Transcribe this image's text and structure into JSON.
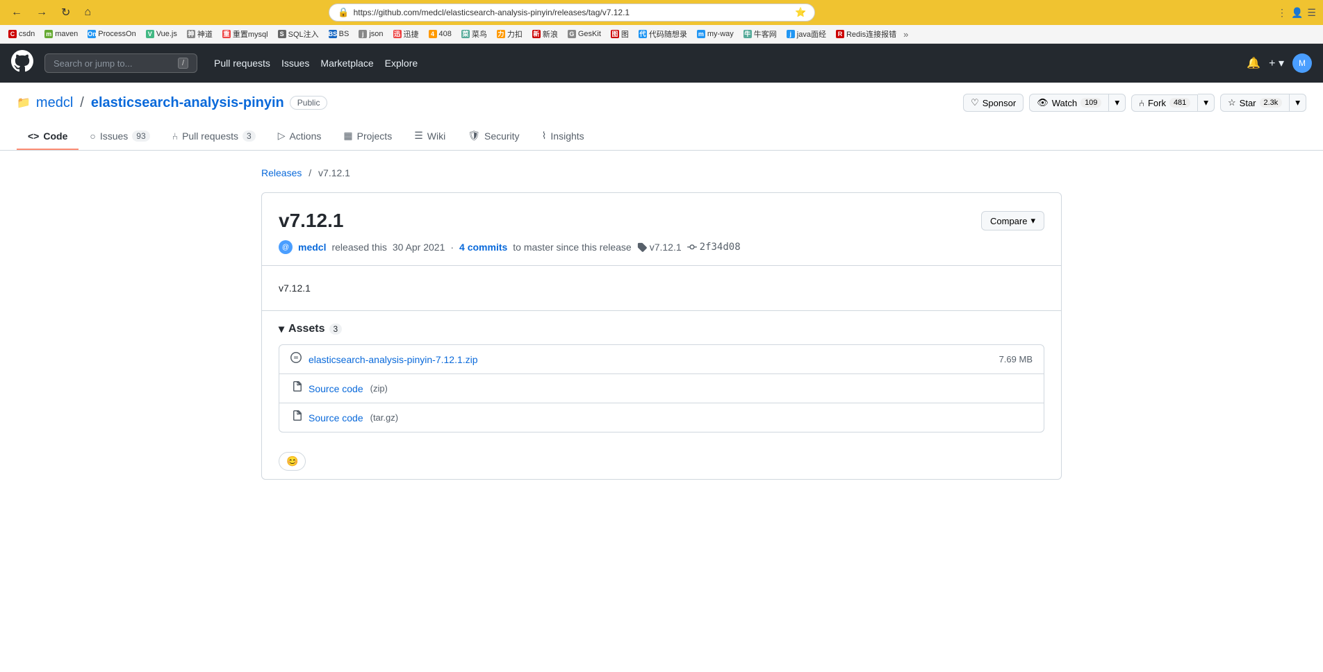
{
  "browser": {
    "url": "https://github.com/medcl/elasticsearch-analysis-pinyin/releases/tag/v7.12.1",
    "bookmarks": [
      {
        "label": "csdn",
        "color": "#c00"
      },
      {
        "label": "maven",
        "color": "#6a3"
      },
      {
        "label": "ProcessOn",
        "color": "#2196F3"
      },
      {
        "label": "Vue.js",
        "color": "#42b883"
      },
      {
        "label": "神道",
        "color": "#888"
      },
      {
        "label": "重置mysql",
        "color": "#e44"
      },
      {
        "label": "SQL注入",
        "color": "#666"
      },
      {
        "label": "BS",
        "color": "#1565C0"
      },
      {
        "label": "json",
        "color": "#888"
      },
      {
        "label": "迅捷",
        "color": "#e44"
      },
      {
        "label": "408",
        "color": "#f90"
      },
      {
        "label": "菜鸟",
        "color": "#5a9"
      },
      {
        "label": "力扣",
        "color": "#f90"
      },
      {
        "label": "新浪",
        "color": "#c00"
      },
      {
        "label": "GesKit",
        "color": "#888"
      },
      {
        "label": "图",
        "color": "#c00"
      },
      {
        "label": "代码随想录",
        "color": "#2196F3"
      },
      {
        "label": "my-way",
        "color": "#2196F3"
      },
      {
        "label": "牛客网",
        "color": "#5a9"
      },
      {
        "label": "java面经",
        "color": "#2196F3"
      },
      {
        "label": "Redis连接报错",
        "color": "#c00"
      }
    ]
  },
  "github": {
    "nav": [
      "Pull requests",
      "Issues",
      "Marketplace",
      "Explore"
    ],
    "search_placeholder": "Search or jump to...",
    "search_shortcut": "/",
    "notification_label": "Notifications",
    "plus_label": "+",
    "avatar_initials": "M"
  },
  "repo": {
    "owner": "medcl",
    "name": "elasticsearch-analysis-pinyin",
    "visibility": "Public",
    "sponsor_label": "Sponsor",
    "watch_label": "Watch",
    "watch_count": "109",
    "fork_label": "Fork",
    "fork_count": "481",
    "star_label": "Star",
    "star_count": "2.3k",
    "tabs": [
      {
        "label": "Code",
        "icon": "<>",
        "active": true,
        "count": null
      },
      {
        "label": "Issues",
        "icon": "○",
        "active": false,
        "count": "93"
      },
      {
        "label": "Pull requests",
        "icon": "⑃",
        "active": false,
        "count": "3"
      },
      {
        "label": "Actions",
        "icon": "▷",
        "active": false,
        "count": null
      },
      {
        "label": "Projects",
        "icon": "▦",
        "active": false,
        "count": null
      },
      {
        "label": "Wiki",
        "icon": "☰",
        "active": false,
        "count": null
      },
      {
        "label": "Security",
        "icon": "⛉",
        "active": false,
        "count": null
      },
      {
        "label": "Insights",
        "icon": "⌇",
        "active": false,
        "count": null
      }
    ]
  },
  "breadcrumb": {
    "releases_label": "Releases",
    "releases_url": "#",
    "current": "v7.12.1"
  },
  "release": {
    "version": "v7.12.1",
    "compare_label": "Compare",
    "avatar_initials": "@",
    "author": "medcl",
    "released_text": "released this",
    "date": "30 Apr 2021",
    "commits_text": "4 commits",
    "commits_suffix": "to master since this release",
    "tag": "v7.12.1",
    "hash": "2f34d08",
    "body_text": "v7.12.1"
  },
  "assets": {
    "title": "Assets",
    "count": "3",
    "triangle": "▾",
    "items": [
      {
        "icon": "📦",
        "name": "elasticsearch-analysis-pinyin-7.12.1.zip",
        "size": "7.69 MB",
        "type": ""
      },
      {
        "icon": "📄",
        "name": "Source code",
        "type": "(zip)",
        "size": ""
      },
      {
        "icon": "📄",
        "name": "Source code",
        "type": "(tar.gz)",
        "size": ""
      }
    ]
  },
  "reactions": {
    "emoji_label": "😊"
  }
}
